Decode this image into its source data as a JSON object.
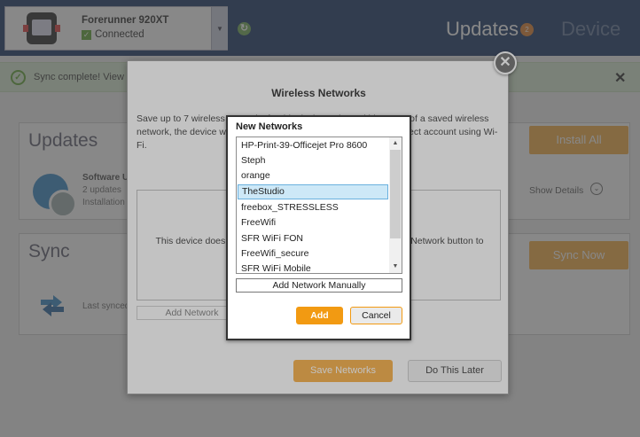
{
  "header": {
    "device_name": "Forerunner 920XT",
    "device_status": "Connected",
    "device_status_icon": "check-icon",
    "sync_icon": "refresh-icon",
    "tabs": [
      {
        "label": "Updates",
        "badge": "2"
      },
      {
        "label": "Device"
      }
    ]
  },
  "banner": {
    "text": "Sync complete! View c",
    "icon": "check-circle-icon",
    "close_label": "✕"
  },
  "updates_panel": {
    "title": "Updates",
    "action_label": "Install All",
    "item_title": "Software U",
    "item_line1": "2 updates",
    "item_line2": "Installation",
    "show_details_label": "Show Details",
    "icon": "gear-icon"
  },
  "sync_panel": {
    "title": "Sync",
    "action_label": "Sync Now",
    "last_synced_label": "Last synced",
    "icon": "sync-arrows-icon"
  },
  "wireless_modal": {
    "title": "Wireless Networks",
    "description": "Save up to 7 wireless networks for this device. When within range of a saved wireless network, the device will automatically upload to your Garmin Connect account using Wi-Fi.",
    "box_text": "This device does not have any saved networks. Click the Add Network button to add a network for this device.",
    "add_network_label": "Add Network",
    "save_label": "Save Networks",
    "later_label": "Do This Later",
    "close_label": "✕"
  },
  "new_networks_dialog": {
    "title": "New Networks",
    "networks": [
      "HP-Print-39-Officejet Pro 8600",
      "Steph",
      "orange",
      "TheStudio",
      "freebox_STRESSLESS",
      "FreeWifi",
      "SFR WiFi FON",
      "FreeWifi_secure",
      "SFR WiFi Mobile"
    ],
    "selected_index": 3,
    "manual_label": "Add Network Manually",
    "add_label": "Add",
    "cancel_label": "Cancel"
  },
  "colors": {
    "topbar": "#0f2d5f",
    "accent_orange": "#f6a93b",
    "add_button": "#f29a12",
    "selected_row": "#cde8f7",
    "banner": "#d8ecd1"
  }
}
